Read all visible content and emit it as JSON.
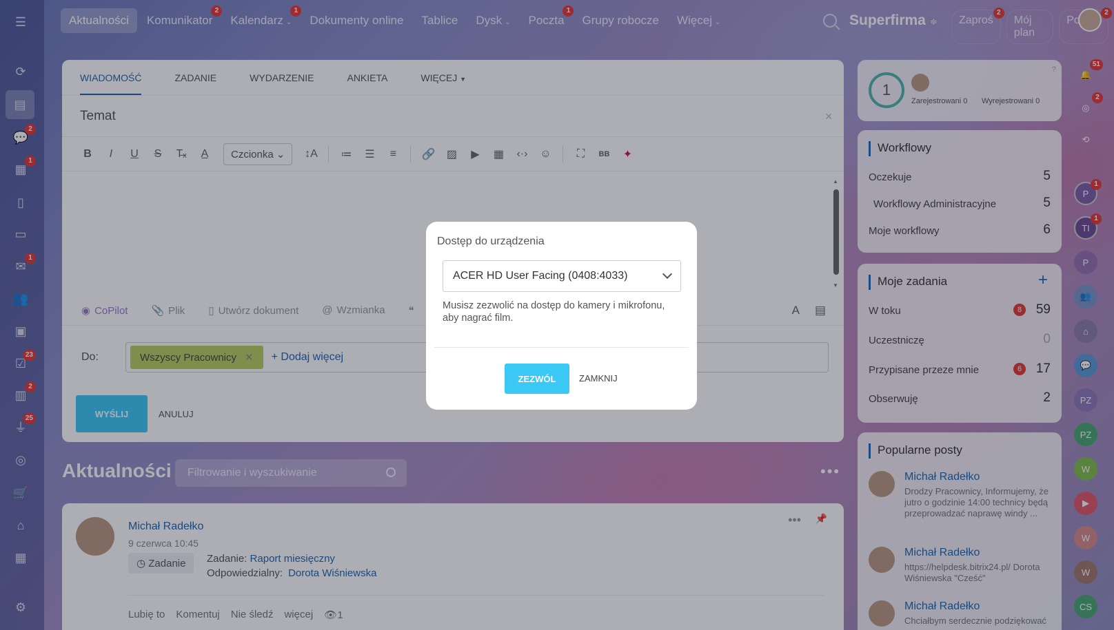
{
  "topnav": {
    "items": [
      {
        "label": "Aktualności",
        "badge": ""
      },
      {
        "label": "Komunikator",
        "badge": "2"
      },
      {
        "label": "Kalendarz",
        "badge": "1"
      },
      {
        "label": "Dokumenty online",
        "badge": ""
      },
      {
        "label": "Tablice",
        "badge": ""
      },
      {
        "label": "Dysk",
        "badge": ""
      },
      {
        "label": "Poczta",
        "badge": "1"
      },
      {
        "label": "Grupy robocze",
        "badge": ""
      },
      {
        "label": "Więcej",
        "badge": ""
      }
    ],
    "brand": "Superfirma",
    "invite": "Zaproś",
    "invite_badge": "2",
    "plan": "Mój plan",
    "help": "Pomoc",
    "help_badge": "2"
  },
  "sidebar_badges": {
    "chat": "2",
    "calendar": "1",
    "mail": "1",
    "tasks": "23",
    "crm": "2",
    "feed": "25"
  },
  "composer": {
    "tabs": [
      "WIADOMOŚĆ",
      "ZADANIE",
      "WYDARZENIE",
      "ANKIETA",
      "WIĘCEJ"
    ],
    "subject_placeholder": "Temat",
    "font_label": "Czcionka",
    "attach": {
      "copilot": "CoPilot",
      "file": "Plik",
      "create_doc": "Utwórz dokument",
      "mention": "Wzmianka"
    },
    "to_label": "Do:",
    "recipient": "Wszyscy Pracownicy",
    "add_more": "+ Dodaj więcej",
    "send": "WYŚLIJ",
    "cancel": "ANULUJ"
  },
  "feed": {
    "title": "Aktualności",
    "filter_placeholder": "Filtrowanie i wyszukiwanie",
    "post": {
      "author": "Michał Radełko",
      "date": "9 czerwca 10:45",
      "tag": "Zadanie",
      "task_prefix": "Zadanie:",
      "task_name": "Raport miesięczny",
      "resp_label": "Odpowiedzialny:",
      "resp_name": "Dorota Wiśniewska",
      "like": "Lubię to",
      "comment": "Komentuj",
      "unfollow": "Nie śledź",
      "more": "więcej",
      "views": "1"
    }
  },
  "presence": {
    "count": "1",
    "registered": "Zarejestrowani 0",
    "unregistered": "Wyrejestrowani 0"
  },
  "workflows": {
    "title": "Workflowy",
    "rows": [
      {
        "label": "Oczekuje",
        "value": "5"
      },
      {
        "label": "Workflowy Administracyjne",
        "value": "5"
      },
      {
        "label": "Moje workflowy",
        "value": "6"
      }
    ]
  },
  "tasks": {
    "title": "Moje zadania",
    "rows": [
      {
        "label": "W toku",
        "badge": "8",
        "value": "59"
      },
      {
        "label": "Uczestniczę",
        "badge": "",
        "value": "0"
      },
      {
        "label": "Przypisane przeze mnie",
        "badge": "6",
        "value": "17"
      },
      {
        "label": "Obserwuję",
        "badge": "",
        "value": "2"
      }
    ]
  },
  "popular": {
    "title": "Popularne posty",
    "posts": [
      {
        "author": "Michał Radełko",
        "text": "Drodzy Pracownicy, Informujemy, że jutro o godzinie 14:00 technicy będą przeprowadzać naprawę windy ..."
      },
      {
        "author": "Michał Radełko",
        "text": "https://helpdesk.bitrix24.pl/ Dorota Wiśniewska \"Cześć\""
      },
      {
        "author": "Michał Radełko",
        "text": "Chciałbym serdecznie podziękować"
      }
    ]
  },
  "rail": {
    "notif_badge": "51",
    "b2": "2",
    "p": "P",
    "p_badge": "1",
    "ti": "TI",
    "ti_badge": "1",
    "pz": "PZ",
    "w": "W",
    "cs": "CS"
  },
  "modal": {
    "title": "Dostęp do urządzenia",
    "device": "ACER HD User Facing (0408:4033)",
    "message": "Musisz zezwolić na dostęp do kamery i mikrofonu, aby nagrać film.",
    "allow": "ZEZWÓL",
    "close": "ZAMKNIJ"
  },
  "colors": {
    "accent": "#2067b0",
    "primary_button": "#3bc8f5",
    "badge": "#e53935",
    "chip": "#bccf5f"
  }
}
